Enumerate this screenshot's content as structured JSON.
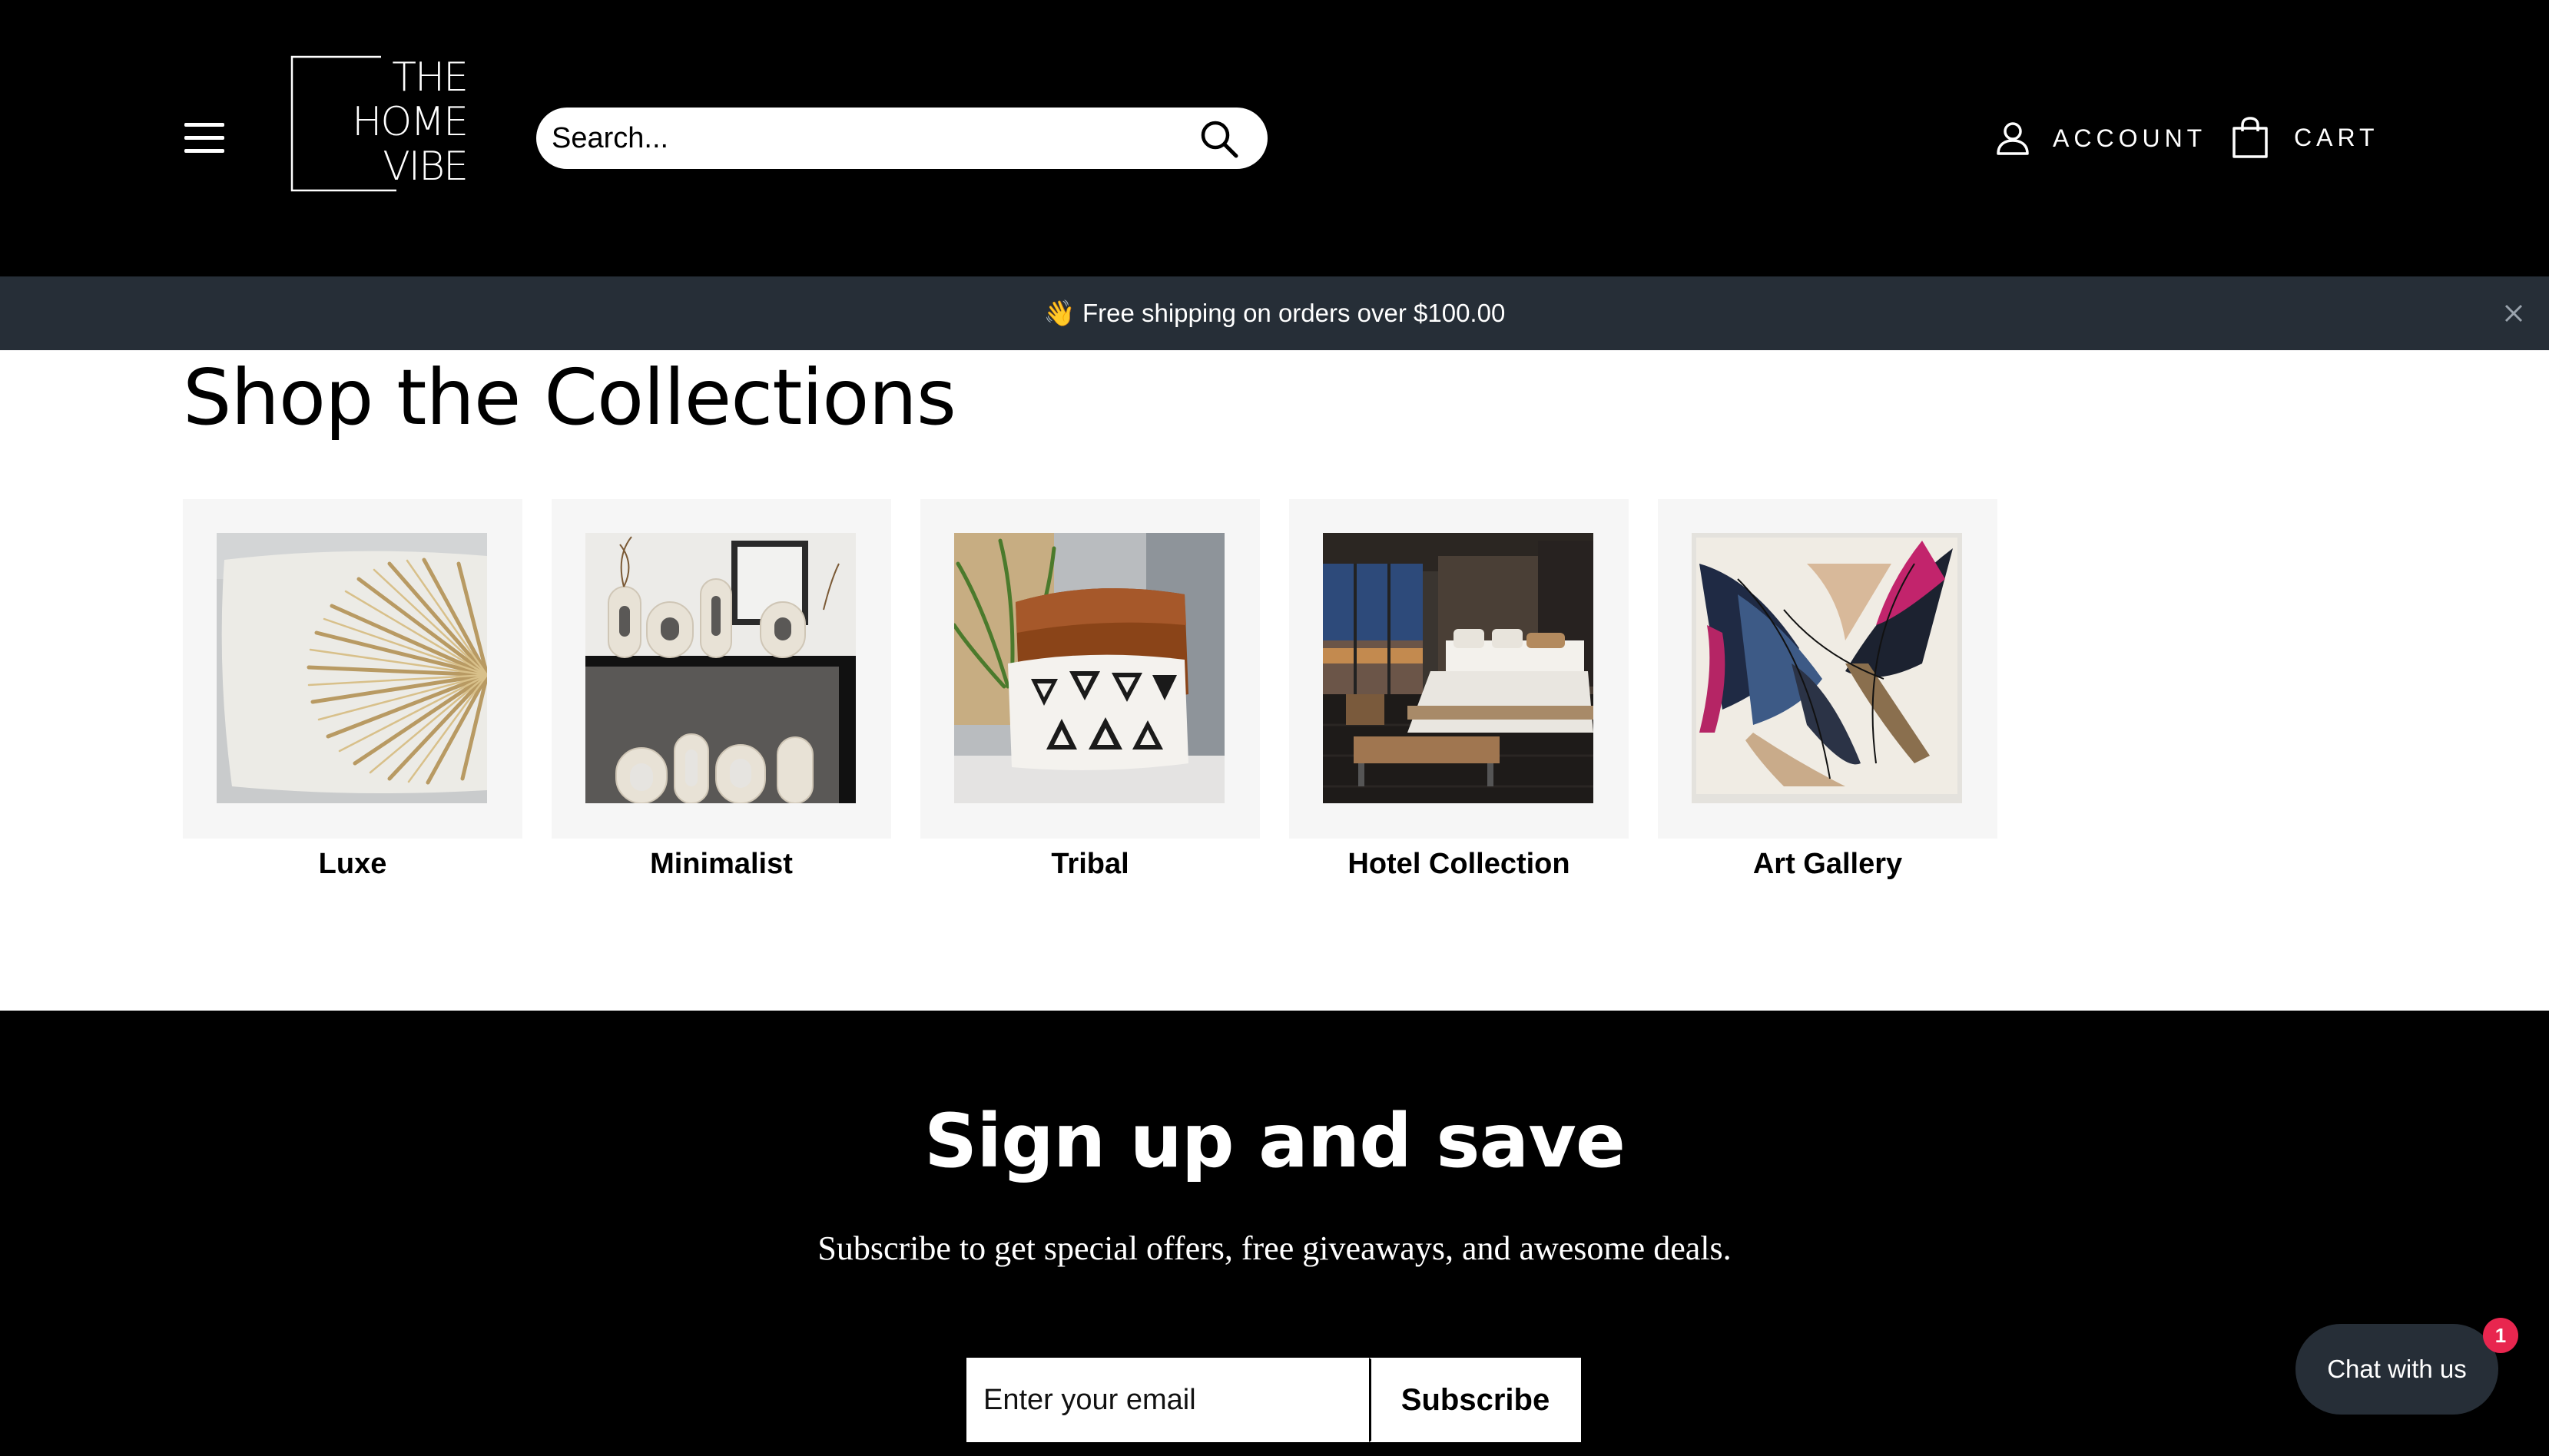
{
  "header": {
    "logo_lines": [
      "THE",
      "HOME",
      "VIBE"
    ],
    "search_placeholder": "Search...",
    "account_label": "ACCOUNT",
    "cart_label": "CART"
  },
  "announcement": {
    "text": "👋 Free shipping on orders over $100.00"
  },
  "collections": {
    "title": "Shop the Collections",
    "items": [
      {
        "label": "Luxe",
        "icon": "beaded-cushion-image"
      },
      {
        "label": "Minimalist",
        "icon": "ceramic-vases-image"
      },
      {
        "label": "Tribal",
        "icon": "triangle-pattern-cushion-image"
      },
      {
        "label": "Hotel Collection",
        "icon": "hotel-bedroom-image"
      },
      {
        "label": "Art Gallery",
        "icon": "abstract-painting-image"
      }
    ]
  },
  "newsletter": {
    "title": "Sign up and save",
    "subtitle": "Subscribe to get special offers, free giveaways, and awesome deals.",
    "email_placeholder": "Enter your email",
    "subscribe_label": "Subscribe"
  },
  "chat": {
    "label": "Chat with us",
    "badge_count": "1"
  },
  "colors": {
    "header_bg": "#000000",
    "announce_bg": "#262e37",
    "card_bg": "#f6f6f6",
    "chat_bg": "#262e37",
    "badge": "#e8264f"
  }
}
